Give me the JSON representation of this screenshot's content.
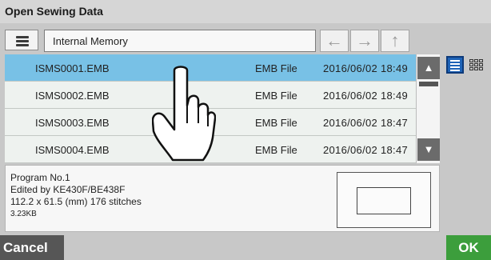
{
  "window": {
    "title": "Open Sewing Data"
  },
  "toolbar": {
    "location": "Internal Memory",
    "icons": {
      "menu": "hamburger-icon",
      "back": "arrow-left-icon",
      "forward": "arrow-right-icon",
      "up": "arrow-up-icon"
    }
  },
  "files": [
    {
      "name": "ISMS0001.EMB",
      "type": "EMB File",
      "date": "2016/06/02 18:49",
      "selected": true
    },
    {
      "name": "ISMS0002.EMB",
      "type": "EMB File",
      "date": "2016/06/02 18:49",
      "selected": false
    },
    {
      "name": "ISMS0003.EMB",
      "type": "EMB File",
      "date": "2016/06/02 18:47",
      "selected": false
    },
    {
      "name": "ISMS0004.EMB",
      "type": "EMB File",
      "date": "2016/06/02 18:47",
      "selected": false
    }
  ],
  "view_modes": {
    "list": "list-view-icon",
    "grid": "grid-view-icon",
    "active": "list"
  },
  "details": {
    "program": "Program No.1",
    "edited_by": "Edited by KE430F/BE438F",
    "dimensions": "112.2 x 61.5 (mm) 176 stitches",
    "size": "3.23KB"
  },
  "buttons": {
    "cancel": "Cancel",
    "ok": "OK"
  },
  "colors": {
    "selected_row": "#78c1e6",
    "ok": "#3c9e3c",
    "cancel": "#565656",
    "view_active": "#1e63b7"
  }
}
